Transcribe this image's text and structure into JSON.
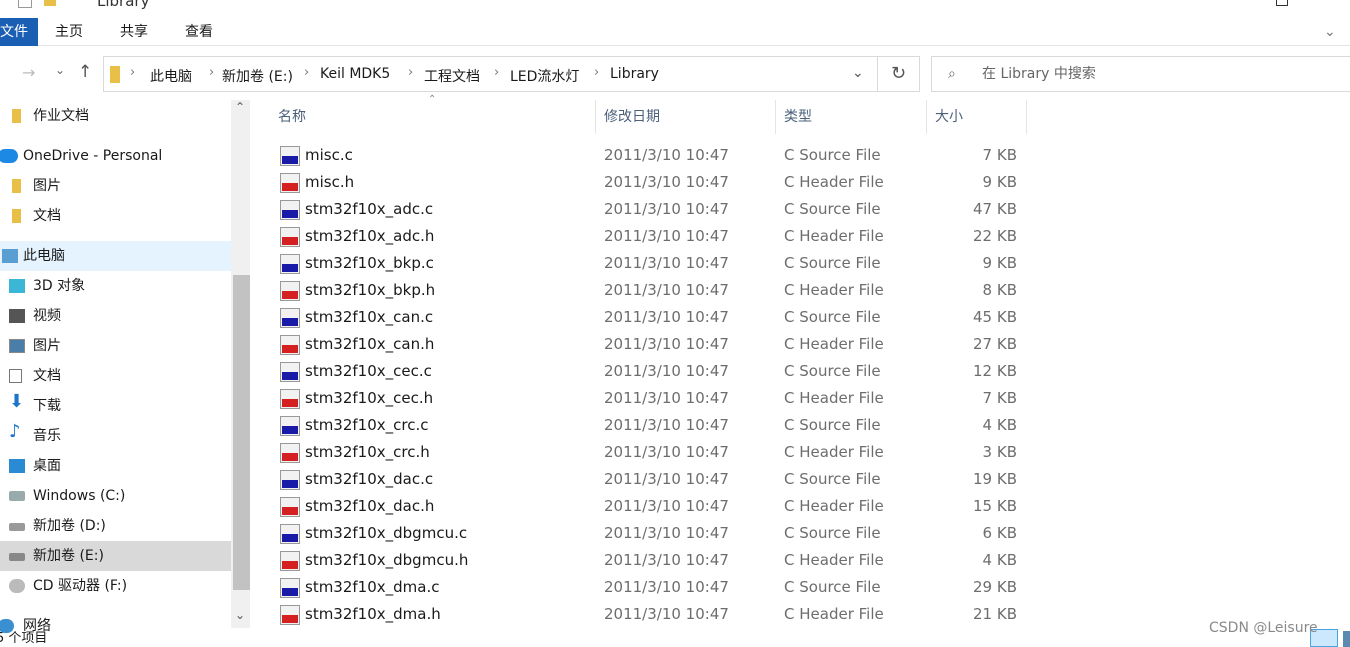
{
  "window": {
    "title": "Library"
  },
  "ribbon": {
    "tabs": [
      "文件",
      "主页",
      "共享",
      "查看"
    ]
  },
  "address": {
    "crumbs": [
      "此电脑",
      "新加卷 (E:)",
      "Keil MDK5",
      "工程文档",
      "LED流水灯",
      "Library"
    ]
  },
  "search": {
    "placeholder": "在 Library 中搜索"
  },
  "sidebar": {
    "items": [
      {
        "label": "作业文档",
        "icon": "folder-icon"
      },
      {
        "label": "OneDrive - Personal",
        "icon": "cloud-icon"
      },
      {
        "label": "图片",
        "icon": "folder-icon"
      },
      {
        "label": "文档",
        "icon": "folder-icon"
      },
      {
        "label": "此电脑",
        "icon": "computer-icon"
      },
      {
        "label": "3D 对象",
        "icon": "cube-icon"
      },
      {
        "label": "视频",
        "icon": "video-icon"
      },
      {
        "label": "图片",
        "icon": "picture-icon"
      },
      {
        "label": "文档",
        "icon": "document-icon"
      },
      {
        "label": "下载",
        "icon": "download-icon"
      },
      {
        "label": "音乐",
        "icon": "music-icon"
      },
      {
        "label": "桌面",
        "icon": "desktop-icon"
      },
      {
        "label": "Windows  (C:)",
        "icon": "drive-icon"
      },
      {
        "label": "新加卷 (D:)",
        "icon": "drive-icon"
      },
      {
        "label": "新加卷 (E:)",
        "icon": "drive-icon"
      },
      {
        "label": "CD 驱动器 (F:)",
        "icon": "cd-drive-icon"
      },
      {
        "label": "网络",
        "icon": "network-icon"
      }
    ]
  },
  "columns": {
    "name": "名称",
    "date": "修改日期",
    "type": "类型",
    "size": "大小"
  },
  "files": [
    {
      "name": "misc.c",
      "date": "2011/3/10 10:47",
      "type": "C Source File",
      "size": "7 KB"
    },
    {
      "name": "misc.h",
      "date": "2011/3/10 10:47",
      "type": "C Header File",
      "size": "9 KB"
    },
    {
      "name": "stm32f10x_adc.c",
      "date": "2011/3/10 10:47",
      "type": "C Source File",
      "size": "47 KB"
    },
    {
      "name": "stm32f10x_adc.h",
      "date": "2011/3/10 10:47",
      "type": "C Header File",
      "size": "22 KB"
    },
    {
      "name": "stm32f10x_bkp.c",
      "date": "2011/3/10 10:47",
      "type": "C Source File",
      "size": "9 KB"
    },
    {
      "name": "stm32f10x_bkp.h",
      "date": "2011/3/10 10:47",
      "type": "C Header File",
      "size": "8 KB"
    },
    {
      "name": "stm32f10x_can.c",
      "date": "2011/3/10 10:47",
      "type": "C Source File",
      "size": "45 KB"
    },
    {
      "name": "stm32f10x_can.h",
      "date": "2011/3/10 10:47",
      "type": "C Header File",
      "size": "27 KB"
    },
    {
      "name": "stm32f10x_cec.c",
      "date": "2011/3/10 10:47",
      "type": "C Source File",
      "size": "12 KB"
    },
    {
      "name": "stm32f10x_cec.h",
      "date": "2011/3/10 10:47",
      "type": "C Header File",
      "size": "7 KB"
    },
    {
      "name": "stm32f10x_crc.c",
      "date": "2011/3/10 10:47",
      "type": "C Source File",
      "size": "4 KB"
    },
    {
      "name": "stm32f10x_crc.h",
      "date": "2011/3/10 10:47",
      "type": "C Header File",
      "size": "3 KB"
    },
    {
      "name": "stm32f10x_dac.c",
      "date": "2011/3/10 10:47",
      "type": "C Source File",
      "size": "19 KB"
    },
    {
      "name": "stm32f10x_dac.h",
      "date": "2011/3/10 10:47",
      "type": "C Header File",
      "size": "15 KB"
    },
    {
      "name": "stm32f10x_dbgmcu.c",
      "date": "2011/3/10 10:47",
      "type": "C Source File",
      "size": "6 KB"
    },
    {
      "name": "stm32f10x_dbgmcu.h",
      "date": "2011/3/10 10:47",
      "type": "C Header File",
      "size": "4 KB"
    },
    {
      "name": "stm32f10x_dma.c",
      "date": "2011/3/10 10:47",
      "type": "C Source File",
      "size": "29 KB"
    },
    {
      "name": "stm32f10x_dma.h",
      "date": "2011/3/10 10:47",
      "type": "C Header File",
      "size": "21 KB"
    }
  ],
  "status": {
    "count": "5 个项目"
  },
  "watermark": "CSDN @Leisure",
  "colors": {
    "accent": "#1a5fb4",
    "source_icon": "#1a1aa8",
    "header_icon": "#d42020"
  }
}
